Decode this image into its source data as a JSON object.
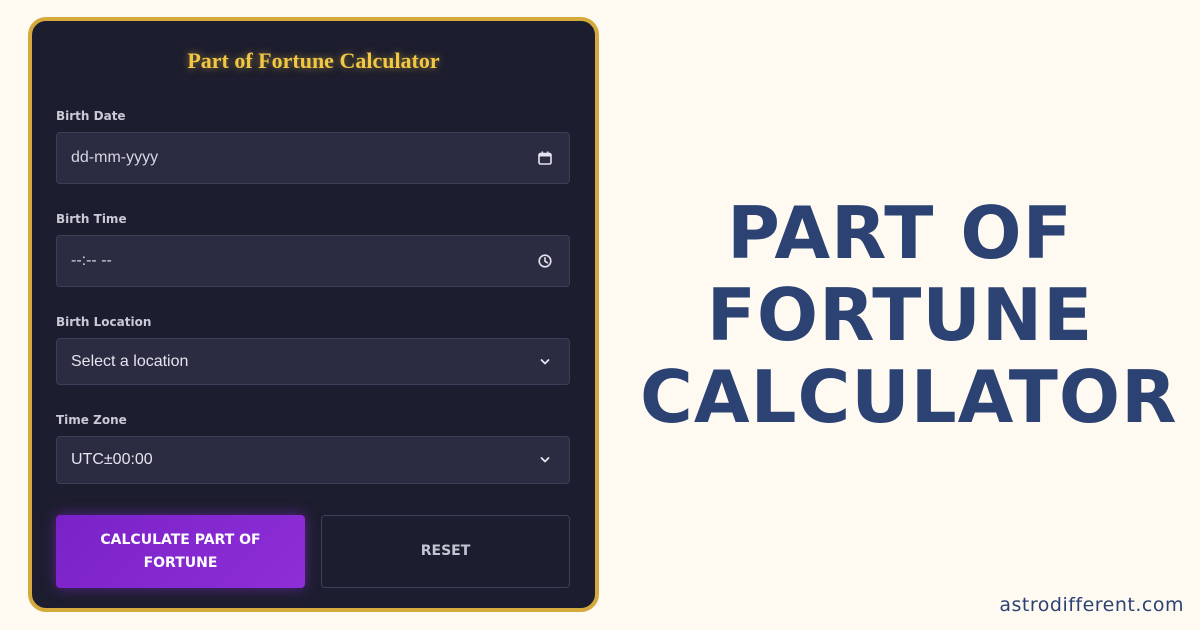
{
  "calculator": {
    "title": "Part of Fortune Calculator",
    "birth_date": {
      "label": "Birth Date",
      "placeholder": "dd-mm-yyyy",
      "icon": "calendar-icon"
    },
    "birth_time": {
      "label": "Birth Time",
      "placeholder": "--:-- --",
      "icon": "clock-icon"
    },
    "birth_location": {
      "label": "Birth Location",
      "selected": "Select a location",
      "icon": "chevron-down-icon"
    },
    "time_zone": {
      "label": "Time Zone",
      "selected": "UTC±00:00",
      "icon": "chevron-down-icon"
    },
    "calculate_label": "CALCULATE PART OF FORTUNE",
    "reset_label": "RESET"
  },
  "headline": {
    "line1": "PART OF",
    "line2": "FORTUNE",
    "line3": "CALCULATOR"
  },
  "brand": "astrodifferent.com",
  "colors": {
    "background": "#fefaf1",
    "card": "#1c1d2e",
    "card_border": "#d4aa3c",
    "title_gold": "#f2c744",
    "primary_button": "#8e2ed6",
    "headline": "#2b4272"
  }
}
